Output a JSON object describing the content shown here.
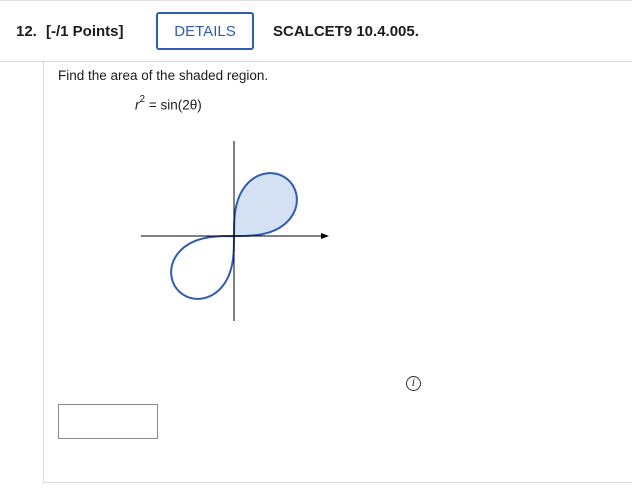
{
  "question": {
    "number": "12.",
    "points": "[-/1 Points]",
    "details_label": "DETAILS",
    "source": "SCALCET9 10.4.005.",
    "prompt": "Find the area of the shaded region.",
    "equation": {
      "lhs_var": "r",
      "lhs_exp": "2",
      "rhs": "= sin(2θ)"
    }
  },
  "graph": {
    "curve": "lemniscate r^2 = sin(2θ)",
    "shaded_loop": "first quadrant",
    "fill_color": "#d4e1f2",
    "stroke_color": "#2f5bb5"
  },
  "answer": {
    "value": "",
    "placeholder": ""
  },
  "info_icon": "info-icon",
  "colors": {
    "accent": "#2f5bb5"
  }
}
